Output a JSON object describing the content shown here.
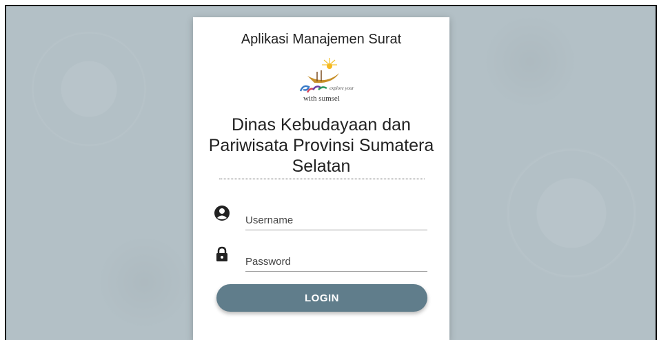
{
  "app": {
    "title": "Aplikasi Manajemen Surat"
  },
  "logo": {
    "alt_text": "explore your with sumsel",
    "tagline": "explore your",
    "wordmark": "with sumsel"
  },
  "organization": {
    "name": "Dinas Kebudayaan dan Pariwisata Provinsi Sumatera Selatan"
  },
  "form": {
    "username": {
      "icon": "user-circle-icon",
      "placeholder": "Username",
      "value": ""
    },
    "password": {
      "icon": "lock-icon",
      "placeholder": "Password",
      "value": ""
    },
    "login_label": "LOGIN"
  },
  "colors": {
    "background": "#b3c0c6",
    "card": "#ffffff",
    "button": "#607d8b",
    "button_text": "#ffffff"
  }
}
